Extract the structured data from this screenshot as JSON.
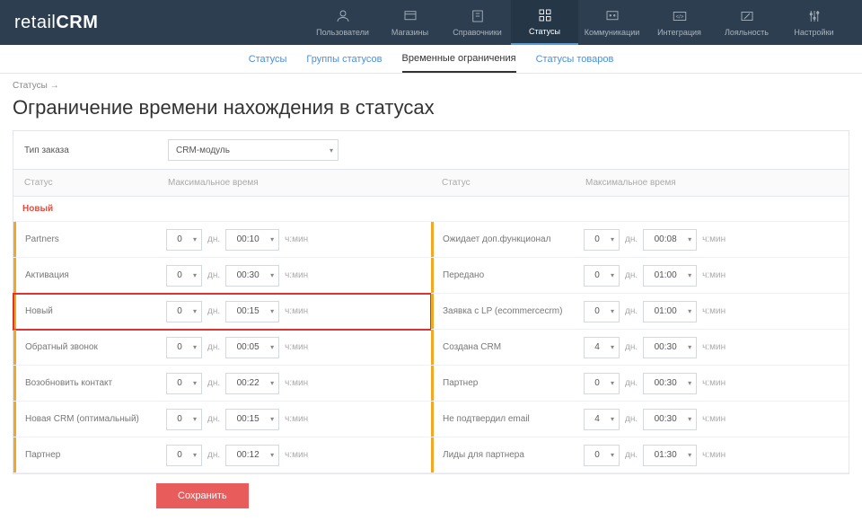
{
  "logo": {
    "a": "retail",
    "b": "CRM"
  },
  "nav": [
    {
      "label": "Пользователи",
      "icon": "user"
    },
    {
      "label": "Магазины",
      "icon": "store"
    },
    {
      "label": "Справочники",
      "icon": "book"
    },
    {
      "label": "Статусы",
      "icon": "grid",
      "active": true
    },
    {
      "label": "Коммуникации",
      "icon": "chat"
    },
    {
      "label": "Интеграция",
      "icon": "link"
    },
    {
      "label": "Лояльность",
      "icon": "percent"
    },
    {
      "label": "Настройки",
      "icon": "sliders"
    }
  ],
  "subnav": [
    {
      "label": "Статусы"
    },
    {
      "label": "Группы статусов"
    },
    {
      "label": "Временные ограничения",
      "active": true
    },
    {
      "label": "Статусы товаров"
    }
  ],
  "breadcrumb": "Статусы →",
  "title": "Ограничение времени нахождения в статусах",
  "orderTypeLabel": "Тип заказа",
  "orderTypeValue": "CRM-модуль",
  "col": {
    "status": "Статус",
    "max": "Максимальное время"
  },
  "unit": {
    "day": "дн.",
    "hm": "ч:мин"
  },
  "section": "Новый",
  "left": [
    {
      "name": "Partners",
      "d": "0",
      "t": "00:10"
    },
    {
      "name": "Активация",
      "d": "0",
      "t": "00:30"
    },
    {
      "name": "Новый",
      "d": "0",
      "t": "00:15",
      "hl": true
    },
    {
      "name": "Обратный звонок",
      "d": "0",
      "t": "00:05"
    },
    {
      "name": "Возобновить контакт",
      "d": "0",
      "t": "00:22"
    },
    {
      "name": "Новая CRM (оптимальный)",
      "d": "0",
      "t": "00:15"
    },
    {
      "name": "Партнер",
      "d": "0",
      "t": "00:12"
    }
  ],
  "right": [
    {
      "name": "Ожидает доп.функционал",
      "d": "0",
      "t": "00:08"
    },
    {
      "name": "Передано",
      "d": "0",
      "t": "01:00"
    },
    {
      "name": "Заявка с LP (ecommercecrm)",
      "d": "0",
      "t": "01:00"
    },
    {
      "name": "Создана CRM",
      "d": "4",
      "t": "00:30"
    },
    {
      "name": "Партнер",
      "d": "0",
      "t": "00:30"
    },
    {
      "name": "Не подтвердил email",
      "d": "4",
      "t": "00:30"
    },
    {
      "name": "Лиды для партнера",
      "d": "0",
      "t": "01:30"
    }
  ],
  "save": "Сохранить"
}
